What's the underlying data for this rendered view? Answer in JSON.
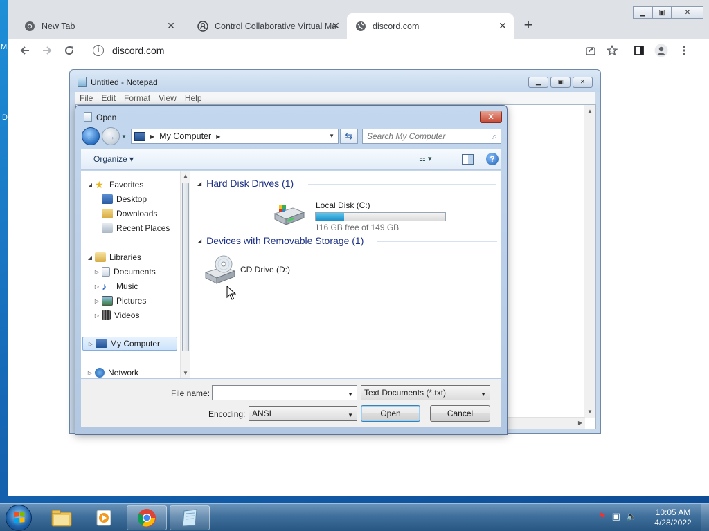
{
  "desktop": {
    "left_glyph_1": "M",
    "left_glyph_2": "D"
  },
  "browser": {
    "tabs": [
      {
        "title": "New Tab",
        "icon": "chrome-icon",
        "active": false
      },
      {
        "title": "Control Collaborative Virtual Ma",
        "icon": "github-icon",
        "active": false
      },
      {
        "title": "discord.com",
        "icon": "globe-icon",
        "active": true
      }
    ],
    "address": "discord.com",
    "new_tab_symbol": "+"
  },
  "notepad": {
    "title": "Untitled - Notepad",
    "menu": [
      "File",
      "Edit",
      "Format",
      "View",
      "Help"
    ]
  },
  "open_dialog": {
    "title": "Open",
    "address_path": "My Computer",
    "search_placeholder": "Search My Computer",
    "organize_label": "Organize",
    "nav": {
      "favorites": "Favorites",
      "desktop": "Desktop",
      "downloads": "Downloads",
      "recent_places": "Recent Places",
      "libraries": "Libraries",
      "documents": "Documents",
      "music": "Music",
      "pictures": "Pictures",
      "videos": "Videos",
      "my_computer": "My Computer",
      "network": "Network"
    },
    "groups": {
      "hard_disks": "Hard Disk Drives (1)",
      "removable": "Devices with Removable Storage (1)"
    },
    "drives": {
      "local_disk": {
        "name": "Local Disk (C:)",
        "free_text": "116 GB free of 149 GB",
        "used_fraction": 0.22
      },
      "cd_drive": {
        "name": "CD Drive (D:)"
      }
    },
    "file_name_label": "File name:",
    "file_name_value": "",
    "file_type": "Text Documents (*.txt)",
    "encoding_label": "Encoding:",
    "encoding_value": "ANSI",
    "open_button": "Open",
    "cancel_button": "Cancel"
  },
  "taskbar": {
    "clock_time": "10:05 AM",
    "clock_date": "4/28/2022"
  }
}
